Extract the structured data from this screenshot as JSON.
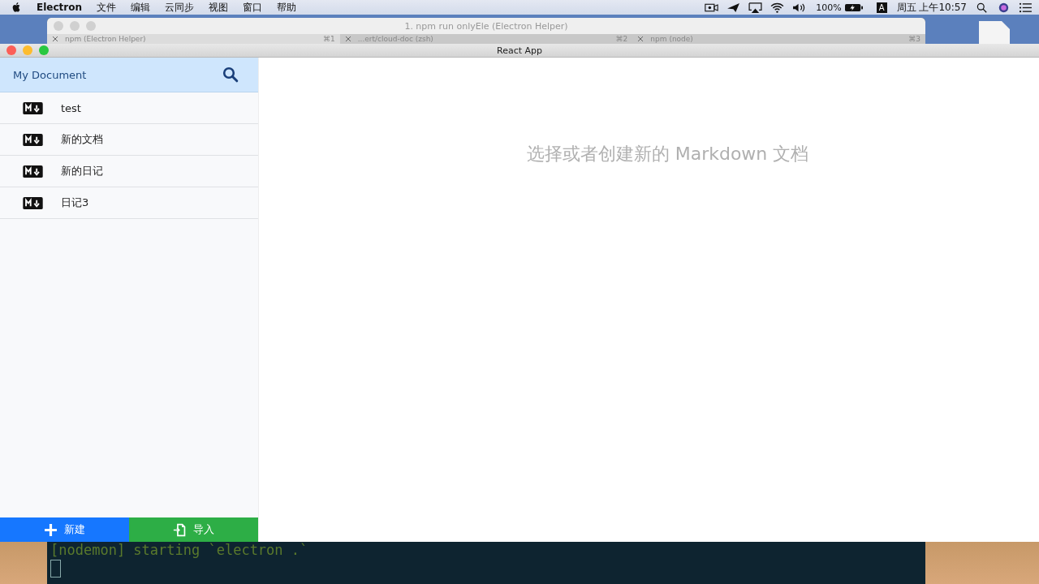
{
  "menu_bar": {
    "app_name": "Electron",
    "menus": [
      "文件",
      "编辑",
      "云同步",
      "视图",
      "窗口",
      "帮助"
    ],
    "battery": "100%",
    "input_source": "A",
    "clock": "周五 上午10:57"
  },
  "terminal": {
    "title": "1. npm run onlyEle (Electron Helper)",
    "tabs": [
      {
        "label": "npm (Electron Helper)",
        "shortcut": "⌘1",
        "selected": true
      },
      {
        "label": "...ert/cloud-doc (zsh)",
        "shortcut": "⌘2",
        "selected": false
      },
      {
        "label": "npm (node)",
        "shortcut": "⌘3",
        "selected": false
      }
    ],
    "output": "[nodemon] starting `electron .`"
  },
  "app": {
    "title": "React App",
    "sidebar": {
      "title": "My Document",
      "files": [
        {
          "name": "test"
        },
        {
          "name": "新的文档"
        },
        {
          "name": "新的日记"
        },
        {
          "name": "日记3"
        }
      ],
      "buttons": [
        {
          "label": "新建",
          "kind": "new"
        },
        {
          "label": "导入",
          "kind": "import"
        }
      ]
    },
    "empty_message": "选择或者创建新的 Markdown 文档"
  }
}
